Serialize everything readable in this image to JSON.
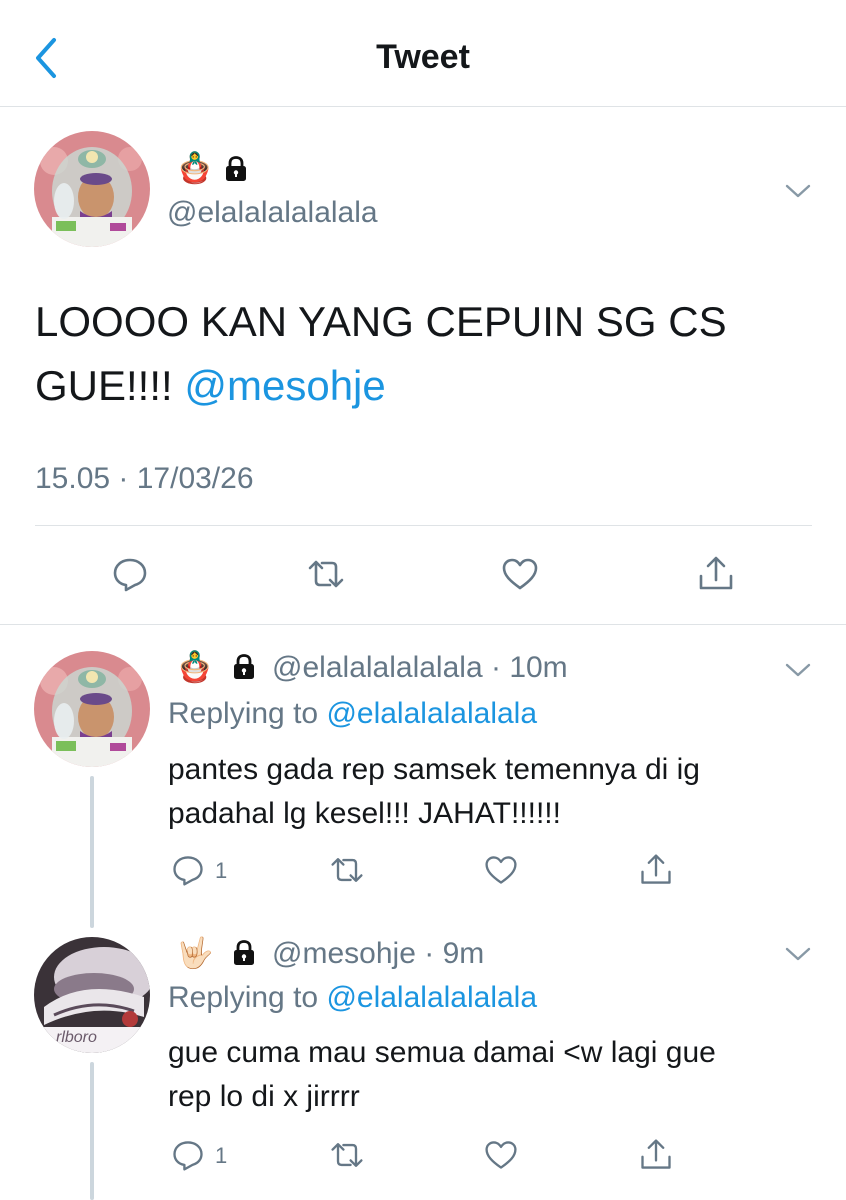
{
  "header": {
    "title": "Tweet"
  },
  "colors": {
    "accent": "#1b95e0",
    "muted": "#657786",
    "text": "#14171a"
  },
  "main_tweet": {
    "emoji": "🪆",
    "handle": "@elalalalalalala",
    "text_line1": "LOOOO KAN YANG CEPUIN SG CS",
    "text_line2_prefix": "GUE!!!! ",
    "mention": "@mesohje",
    "timestamp": "15.05 · 17/03/26"
  },
  "replies": [
    {
      "emoji": "🪆",
      "handle": "@elalalalalalala",
      "sep": " · ",
      "time": "10m",
      "replying_label": "Replying to ",
      "replying_to": "@elalalalalalala",
      "line1": "pantes gada rep samsek temennya di ig",
      "line2": "padahal lg kesel!!! JAHAT!!!!!!",
      "reply_count": "1"
    },
    {
      "emoji": "🤟🏻",
      "handle": "@mesohje",
      "sep": " · ",
      "time": "9m",
      "replying_label": "Replying to ",
      "replying_to": "@elalalalalalala",
      "line1": "gue cuma mau semua damai <w lagi gue",
      "line2": "rep lo di x jirrrr",
      "reply_count": "1",
      "avatar_text": "rlboro"
    }
  ],
  "icons": [
    "back-chevron-icon",
    "lock-icon",
    "chevron-down-icon",
    "reply-icon",
    "retweet-icon",
    "like-icon",
    "share-icon"
  ]
}
